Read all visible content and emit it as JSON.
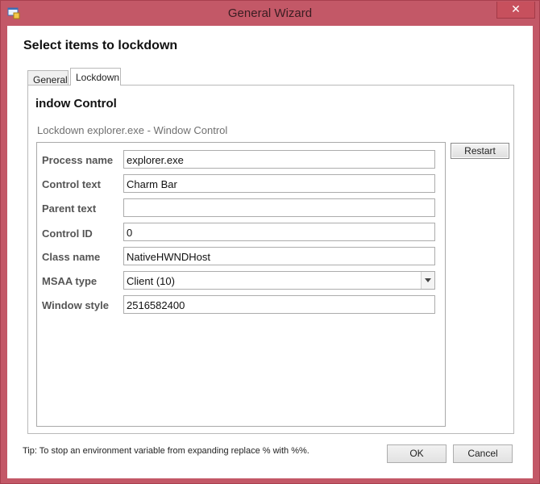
{
  "window": {
    "title": "General Wizard",
    "close_glyph": "✕"
  },
  "page": {
    "heading": "Select items to lockdown"
  },
  "tabs": [
    {
      "label": "General",
      "selected": false
    },
    {
      "label": "Lockdown",
      "selected": true
    }
  ],
  "panel": {
    "title": "indow Control",
    "subtitle": "Lockdown explorer.exe - Window Control",
    "restart_label": "Restart"
  },
  "fields": {
    "process_name": {
      "label": "Process name",
      "value": "explorer.exe"
    },
    "control_text": {
      "label": "Control text",
      "value": "Charm Bar"
    },
    "parent_text": {
      "label": "Parent text",
      "value": ""
    },
    "control_id": {
      "label": "Control ID",
      "value": "0"
    },
    "class_name": {
      "label": "Class name",
      "value": "NativeHWNDHost"
    },
    "msaa_type": {
      "label": "MSAA type",
      "value": "Client (10)"
    },
    "window_style": {
      "label": "Window style",
      "value": "2516582400"
    }
  },
  "footer": {
    "tip": "Tip: To stop an environment variable from expanding replace % with %%.",
    "ok_label": "OK",
    "cancel_label": "Cancel"
  },
  "colors": {
    "title_bar": "#c35867",
    "window_border": "#a8404e",
    "close_button": "#c7505d"
  }
}
